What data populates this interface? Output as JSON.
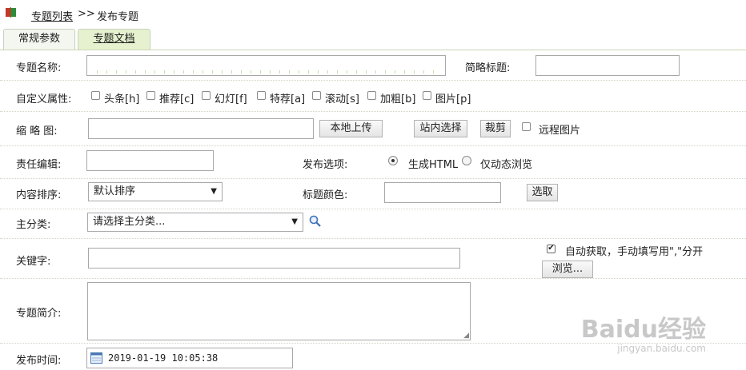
{
  "breadcrumb": {
    "list_link": "专题列表",
    "separator": ">>",
    "current": "发布专题"
  },
  "tabs": [
    {
      "label": "常规参数"
    },
    {
      "label": "专题文档"
    }
  ],
  "form": {
    "name_label": "专题名称:",
    "short_title_label": "简略标题:",
    "custom_attr_label": "自定义属性:",
    "custom_attrs": [
      "头条[h]",
      "推荐[c]",
      "幻灯[f]",
      "特荐[a]",
      "滚动[s]",
      "加粗[b]",
      "图片[p]"
    ],
    "thumb_label": "缩 略 图:",
    "local_upload": "本地上传",
    "site_select": "站内选择",
    "crop": "裁剪",
    "remote_image": "远程图片",
    "editor_label": "责任编辑:",
    "publish_option_label": "发布选项:",
    "publish_options": [
      "生成HTML",
      "仅动态浏览"
    ],
    "publish_selected": "生成HTML",
    "sort_label": "内容排序:",
    "sort_value": "默认排序",
    "title_color_label": "标题颜色:",
    "pick_button": "选取",
    "main_cat_label": "主分类:",
    "main_cat_value": "请选择主分类...",
    "keywords_label": "关键字:",
    "auto_fetch_label": "自动获取，手动填写用\",\"分开",
    "auto_fetch_checked": true,
    "browse_button": "浏览...",
    "intro_label": "专题简介:",
    "time_label": "发布时间:",
    "time_value": "2019-01-19 10:05:38"
  },
  "watermark": {
    "text": "Baidu经验",
    "url": "jingyan.baidu.com"
  }
}
